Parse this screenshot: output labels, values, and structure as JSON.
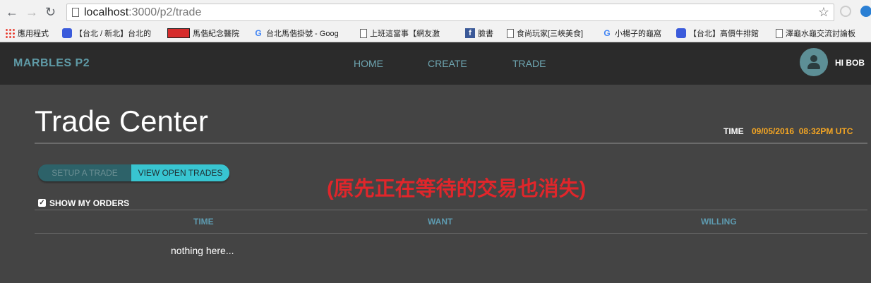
{
  "browser": {
    "url_host": "localhost",
    "url_path": ":3000/p2/trade",
    "bookmarks": [
      {
        "icon": "apps-icon",
        "label": "應用程式"
      },
      {
        "icon": "favicon-blue-icon",
        "label": "【台北 / 新北】台北的"
      },
      {
        "icon": "favicon-red-icon",
        "label": "馬偕紀念醫院"
      },
      {
        "icon": "google-icon",
        "label": "台北馬偕掛號 - Goog"
      },
      {
        "icon": "page-icon",
        "label": "上班這當事【網友激"
      },
      {
        "icon": "facebook-icon",
        "label": "臉書"
      },
      {
        "icon": "page-icon",
        "label": "食尚玩家[三峽美食]"
      },
      {
        "icon": "google-icon",
        "label": "小楊子的龜窩"
      },
      {
        "icon": "favicon-blue-icon",
        "label": "【台北】高價牛排館"
      },
      {
        "icon": "page-icon",
        "label": "澤龜水龜交流討論板"
      }
    ]
  },
  "app": {
    "brand": "MARBLES P2",
    "nav": [
      "HOME",
      "CREATE",
      "TRADE"
    ],
    "greeting": "HI BOB"
  },
  "page": {
    "title": "Trade Center",
    "time_label": "TIME",
    "time_value": "09/05/2016  08:32PM UTC",
    "tabs": [
      "SETUP A TRADE",
      "VIEW OPEN TRADES"
    ],
    "notice": "(原先正在等待的交易也消失)",
    "show_orders_label": "SHOW MY ORDERS",
    "show_orders_checked": true,
    "table_headers": [
      "TIME",
      "WANT",
      "WILLING"
    ],
    "empty_text": "nothing here..."
  },
  "colors": {
    "header_bg": "#2b2b2b",
    "page_bg": "#444444",
    "accent": "#38c5d1",
    "time_value": "#f5a623",
    "notice": "#e0262b"
  }
}
